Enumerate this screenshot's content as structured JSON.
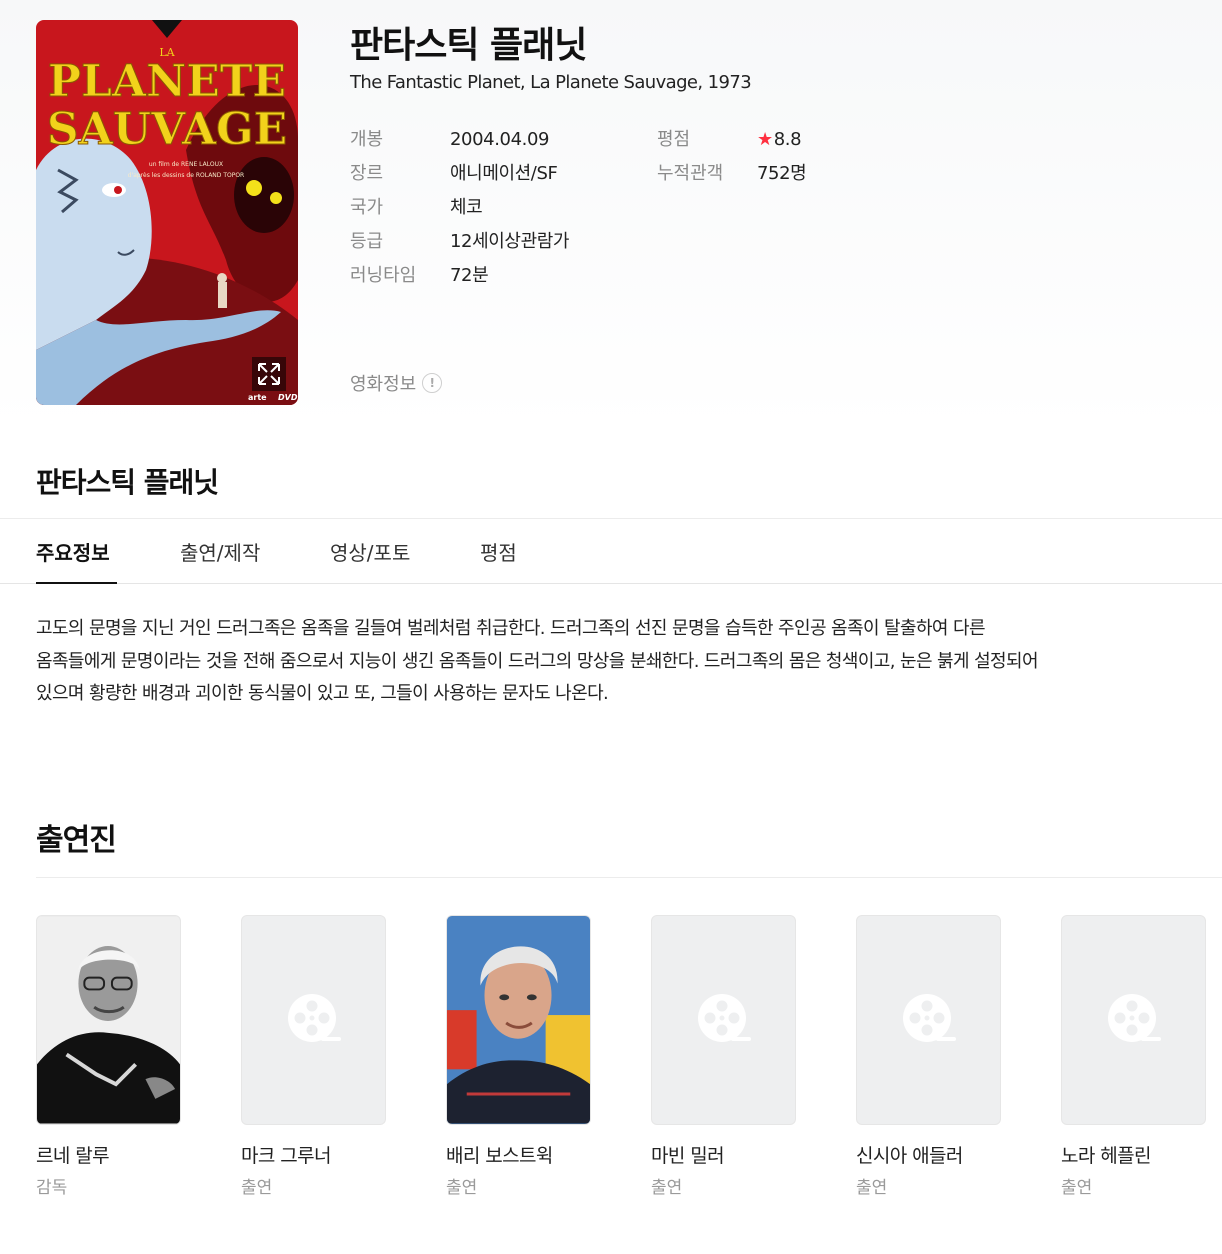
{
  "movie": {
    "title": "판타스틱 플래닛",
    "subtitle": "The Fantastic Planet, La Planete Sauvage, 1973",
    "poster": {
      "top_text": "LA",
      "title_line1": "PLANETE",
      "title_line2": "SAUVAGE",
      "credit1": "un film de RENE LALOUX",
      "credit2": "d'après les dessins de ROLAND TOPOR",
      "logo1": "arte",
      "logo2": "DVD"
    },
    "info_left": [
      {
        "label": "개봉",
        "value": "2004.04.09"
      },
      {
        "label": "장르",
        "value": "애니메이션/SF"
      },
      {
        "label": "국가",
        "value": "체코"
      },
      {
        "label": "등급",
        "value": "12세이상관람가"
      },
      {
        "label": "러닝타임",
        "value": "72분"
      }
    ],
    "info_right": [
      {
        "label": "평점",
        "value": "8.8"
      },
      {
        "label": "누적관객",
        "value": "752명"
      }
    ],
    "info_link": "영화정보",
    "info_link_icon": "!"
  },
  "section_title": "판타스틱 플래닛",
  "tabs": [
    "주요정보",
    "출연/제작",
    "영상/포토",
    "평점"
  ],
  "synopsis": "고도의 문명을 지닌 거인 드러그족은 옴족을 길들여 벌레처럼 취급한다. 드러그족의 선진 문명을 습득한 주인공 옴족이 탈출하여 다른 옴족들에게 문명이라는 것을 전해 줌으로서 지능이 생긴 옴족들이 드러그의 망상을 분쇄한다. 드러그족의 몸은 청색이고, 눈은 붉게 설정되어 있으며 황량한 배경과 괴이한 동식물이 있고 또, 그들이 사용하는 문자도 나온다.",
  "cast_title": "출연진",
  "cast": [
    {
      "name": "르네 랄루",
      "role": "감독",
      "photo": "photo"
    },
    {
      "name": "마크 그루너",
      "role": "출연",
      "photo": "placeholder"
    },
    {
      "name": "배리 보스트윅",
      "role": "출연",
      "photo": "photo"
    },
    {
      "name": "마빈 밀러",
      "role": "출연",
      "photo": "placeholder"
    },
    {
      "name": "신시아 애들러",
      "role": "출연",
      "photo": "placeholder"
    },
    {
      "name": "노라 헤플린",
      "role": "출연",
      "photo": "placeholder"
    }
  ],
  "colors": {
    "star": "#ff2f40",
    "poster_bg": "#c8161d",
    "poster_title": "#f2d21b",
    "placeholder_bg": "#eeeff0"
  },
  "icons": {
    "star": "star-icon",
    "expand": "expand-icon",
    "info": "info-icon",
    "film_reel": "film-reel-icon"
  }
}
